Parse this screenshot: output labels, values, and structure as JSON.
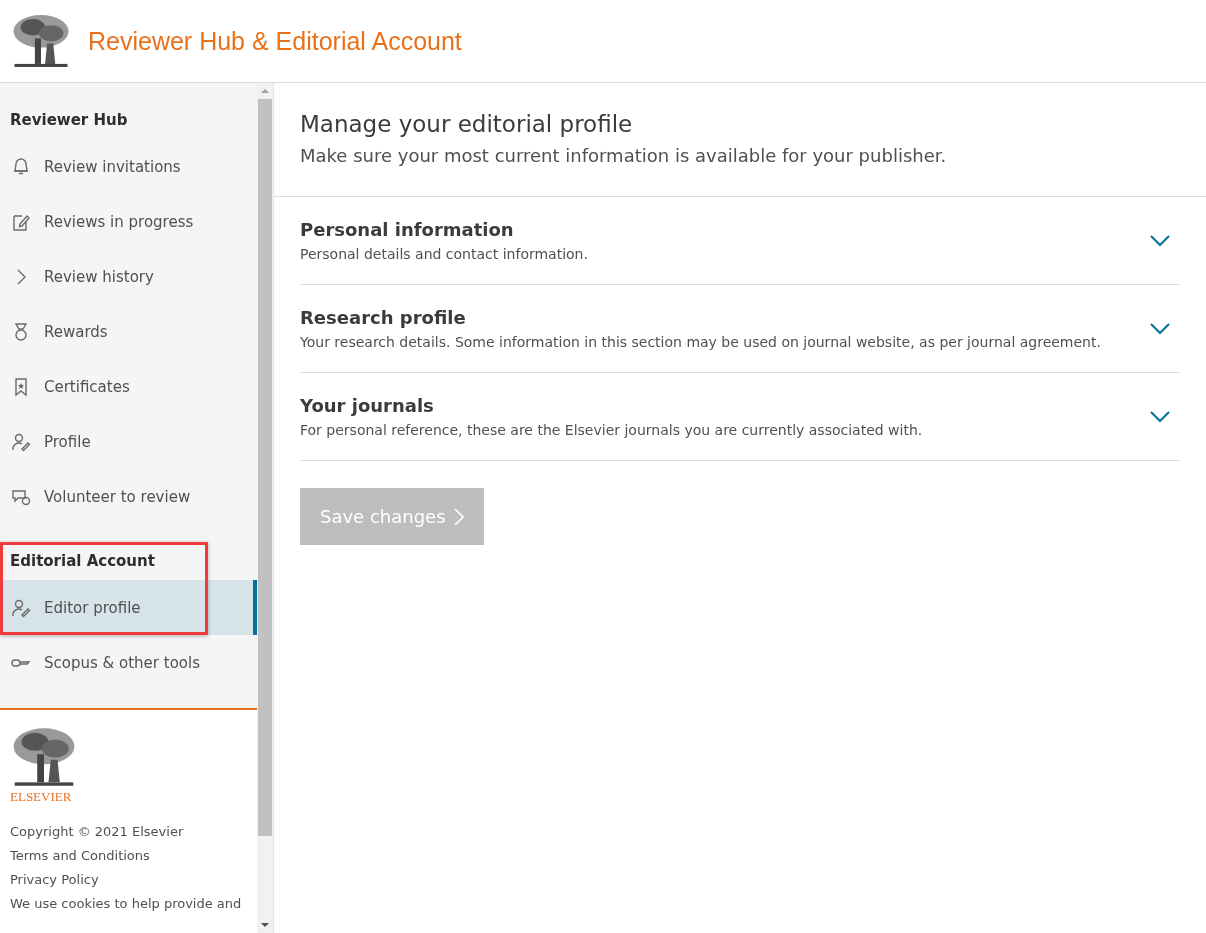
{
  "header": {
    "title": "Reviewer Hub & Editorial Account"
  },
  "sidebar": {
    "sections": [
      {
        "title": "Reviewer Hub",
        "items": [
          {
            "label": "Review invitations",
            "selected": false
          },
          {
            "label": "Reviews in progress",
            "selected": false
          },
          {
            "label": "Review history",
            "selected": false
          },
          {
            "label": "Rewards",
            "selected": false
          },
          {
            "label": "Certificates",
            "selected": false
          },
          {
            "label": "Profile",
            "selected": false
          },
          {
            "label": "Volunteer to review",
            "selected": false
          }
        ]
      },
      {
        "title": "Editorial Account",
        "highlighted": true,
        "items": [
          {
            "label": "Editor profile",
            "selected": true
          },
          {
            "label": "Scopus & other tools",
            "selected": false
          }
        ]
      }
    ],
    "footer": {
      "logo_text": "ELSEVIER",
      "lines": [
        "Copyright © 2021 Elsevier",
        "Terms and Conditions",
        "Privacy Policy",
        "We use cookies to help provide and"
      ]
    }
  },
  "main": {
    "title": "Manage your editorial profile",
    "subtitle": "Make sure your most current information is available for your publisher.",
    "sections": [
      {
        "title": "Personal information",
        "description": "Personal details and contact information.",
        "expanded": false
      },
      {
        "title": "Research profile",
        "description": "Your research details. Some information in this section may be used on journal website, as per journal agreement.",
        "expanded": false
      },
      {
        "title": "Your journals",
        "description": "For personal reference, these are the Elsevier journals you are currently associated with.",
        "expanded": false
      }
    ],
    "save_button": {
      "label": "Save changes",
      "disabled": true
    }
  }
}
